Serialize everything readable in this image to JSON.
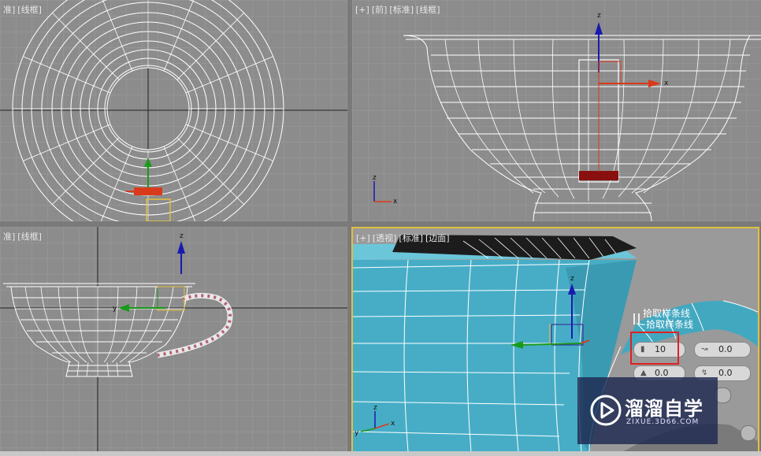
{
  "viewports": {
    "top": {
      "labels": [
        "准]",
        "[线框]"
      ]
    },
    "front": {
      "labels": [
        "[+]",
        "[前]",
        "[标准]",
        "[线框]"
      ]
    },
    "left": {
      "labels": [
        "准]",
        "[线框]"
      ]
    },
    "perspective": {
      "labels": [
        "[+]",
        "[透视]",
        "[标准]",
        "[边面]"
      ]
    }
  },
  "axes": {
    "x": "x",
    "y": "y",
    "z": "z"
  },
  "pick_panel": {
    "title1": "拾取样条线",
    "title2": "~拾取样条线",
    "spinners": {
      "steps": "10",
      "value_a": "0.0",
      "value_b": "0.0",
      "value_c": "0.0"
    }
  },
  "watermark": {
    "name": "溜溜自学",
    "url": "ZIXUE.3D66.COM"
  },
  "colors": {
    "viewport_bg": "#8c8c8c",
    "active_border": "#e0c040",
    "cup_shaded": "#4ab0c8",
    "highlight": "#e02020"
  }
}
